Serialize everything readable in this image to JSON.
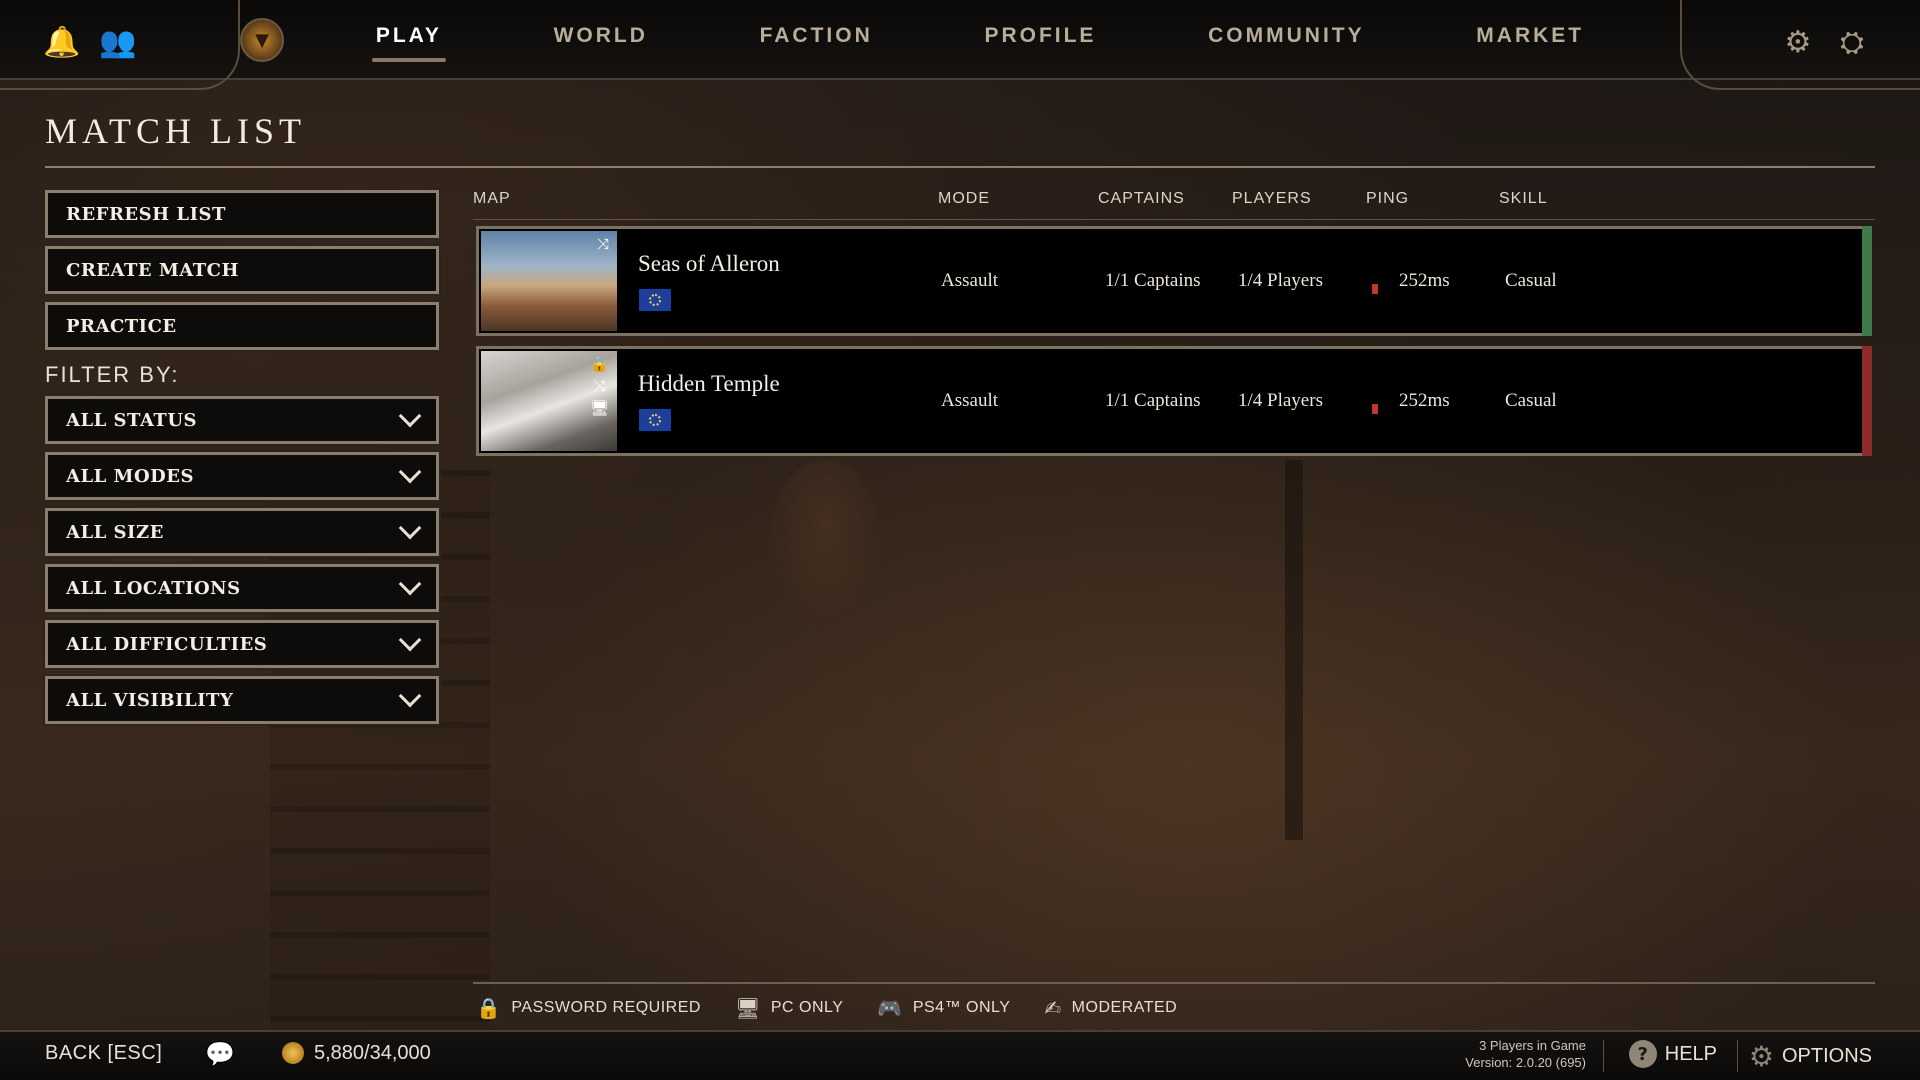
{
  "nav": {
    "items": [
      "PLAY",
      "WORLD",
      "FACTION",
      "PROFILE",
      "COMMUNITY",
      "MARKET"
    ],
    "active": "PLAY"
  },
  "icons": {
    "bell": "bell-icon",
    "friends": "friends-icon",
    "emblem": "faction-emblem-icon",
    "crew_settings": "crew-settings-icon",
    "ship_settings": "ship-settings-icon"
  },
  "page": {
    "title": "MATCH LIST"
  },
  "actions": {
    "refresh": "REFRESH LIST",
    "create": "CREATE MATCH",
    "practice": "PRACTICE"
  },
  "filters": {
    "label": "FILTER BY:",
    "items": [
      "ALL STATUS",
      "ALL MODES",
      "ALL SIZE",
      "ALL LOCATIONS",
      "ALL DIFFICULTIES",
      "ALL VISIBILITY"
    ]
  },
  "table": {
    "headers": {
      "map": "MAP",
      "mode": "MODE",
      "captains": "CAPTAINS",
      "players": "PLAYERS",
      "ping": "PING",
      "skill": "SKILL"
    },
    "rows": [
      {
        "map": "Seas of Alleron",
        "mode": "Assault",
        "captains": "1/1 Captains",
        "players": "1/4 Players",
        "ping": "252ms",
        "skill": "Casual",
        "status_color": "#3f7a4a",
        "region": "EU",
        "flags": [
          "shuffle"
        ]
      },
      {
        "map": "Hidden Temple",
        "mode": "Assault",
        "captains": "1/1 Captains",
        "players": "1/4 Players",
        "ping": "252ms",
        "skill": "Casual",
        "status_color": "#8e2a2a",
        "region": "EU",
        "flags": [
          "password",
          "shuffle",
          "pc-only"
        ]
      }
    ]
  },
  "legend": {
    "password": "PASSWORD REQUIRED",
    "pc_only": "PC ONLY",
    "ps4_only": "PS4™ ONLY",
    "moderated": "MODERATED"
  },
  "footer": {
    "back": "BACK [ESC]",
    "currency": "5,880/34,000",
    "players_in_game": "3 Players in Game",
    "version": "Version: 2.0.20 (695)",
    "help": "HELP",
    "options": "OPTIONS"
  },
  "colors": {
    "accent_border": "#8b7f6c",
    "ping_bar": "#c0392b",
    "open_status": "#3f7a4a",
    "locked_status": "#8e2a2a"
  }
}
